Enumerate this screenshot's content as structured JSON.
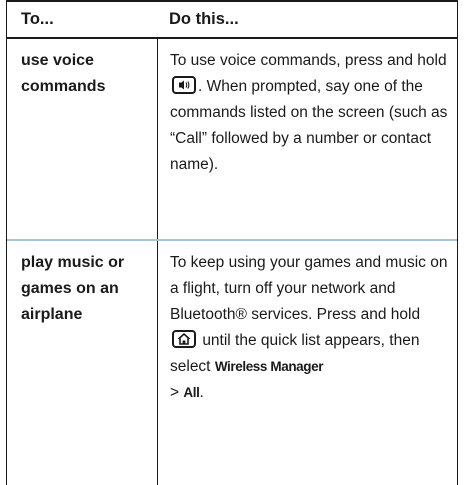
{
  "header": {
    "col1": "To...",
    "col2": "Do this..."
  },
  "rows": [
    {
      "action_line1": "use voice",
      "action_line2": "commands",
      "desc_a": "To use voice commands, press and hold",
      "icon": "voice-key-icon",
      "desc_b": ". When prompted, say one of the commands listed on the screen (such as “Call” followed by a number or contact name)."
    },
    {
      "action_line1": "play music or",
      "action_line2": "games on an",
      "action_line3": "airplane",
      "desc_a": "To keep using your games and music on a flight, turn off your network and",
      "desc_b": "Bluetooth® services. Press and hold",
      "icon": "home-key-icon",
      "desc_c": "until the quick list appears, then select",
      "menu1": "Wireless Manager",
      "sep": ">",
      "menu2": "All",
      "end": "."
    }
  ]
}
